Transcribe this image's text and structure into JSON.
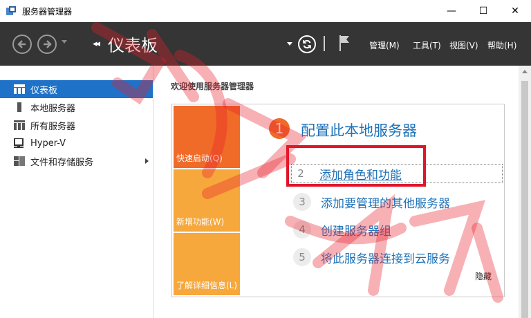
{
  "window": {
    "title": "服务器管理器",
    "minimize": "—",
    "maximize": "☐",
    "close": "✕"
  },
  "toolbar": {
    "breadcrumb_arrows": "◂◂",
    "breadcrumb_title": "仪表板",
    "menus": [
      "管理(M)",
      "工具(T)",
      "视图(V)",
      "帮助(H)"
    ]
  },
  "sidebar": {
    "items": [
      {
        "label": "仪表板",
        "icon": "dashboard-icon",
        "active": true
      },
      {
        "label": "本地服务器",
        "icon": "server-icon"
      },
      {
        "label": "所有服务器",
        "icon": "servers-icon"
      },
      {
        "label": "Hyper-V",
        "icon": "hyperv-icon"
      },
      {
        "label": "文件和存储服务",
        "icon": "storage-icon",
        "has_arrow": true
      }
    ]
  },
  "main": {
    "welcome": "欢迎使用服务器管理器",
    "tiles": [
      "快速启动(Q)",
      "新增功能(W)",
      "了解详细信息(L)"
    ],
    "headline_number": "1",
    "headline": "配置此本地服务器",
    "steps": [
      {
        "num": "2",
        "label": "添加角色和功能"
      },
      {
        "num": "3",
        "label": "添加要管理的其他服务器"
      },
      {
        "num": "4",
        "label": "创建服务器组"
      },
      {
        "num": "5",
        "label": "将此服务器连接到云服务"
      }
    ],
    "hide": "隐藏"
  },
  "colors": {
    "accent_blue": "#1e72b8",
    "tile_orange": "#f06a28",
    "tile_yellow": "#f6a83c",
    "highlight_red": "#e0152a"
  }
}
